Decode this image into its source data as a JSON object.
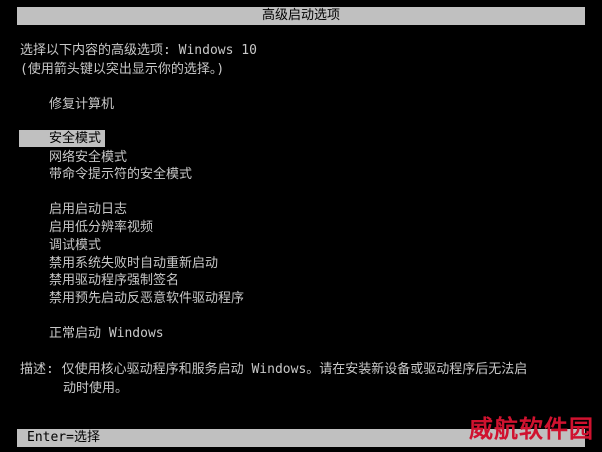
{
  "title": "高级启动选项",
  "prompt": {
    "line1": "选择以下内容的高级选项: Windows 10",
    "line2": "(使用箭头键以突出显示你的选择。)"
  },
  "menu": {
    "repair": "修复计算机",
    "safe_mode": "安全模式",
    "safe_mode_network": "网络安全模式",
    "safe_mode_cmd": "带命令提示符的安全模式",
    "boot_logging": "启用启动日志",
    "low_res_video": "启用低分辨率视频",
    "debug_mode": "调试模式",
    "disable_auto_restart": "禁用系统失败时自动重新启动",
    "disable_driver_sig": "禁用驱动程序强制签名",
    "disable_elam": "禁用预先启动反恶意软件驱动程序",
    "start_normal": "正常启动 Windows"
  },
  "description": {
    "line1": "描述: 仅使用核心驱动程序和服务启动 Windows。请在安装新设备或驱动程序后无法启",
    "line2": "动时使用。"
  },
  "status": "Enter=选择",
  "watermark": "威航软件园",
  "colors": {
    "background": "#000000",
    "text": "#c8c8c8",
    "highlight": "#c0c0c0",
    "watermark": "#d0122f"
  }
}
